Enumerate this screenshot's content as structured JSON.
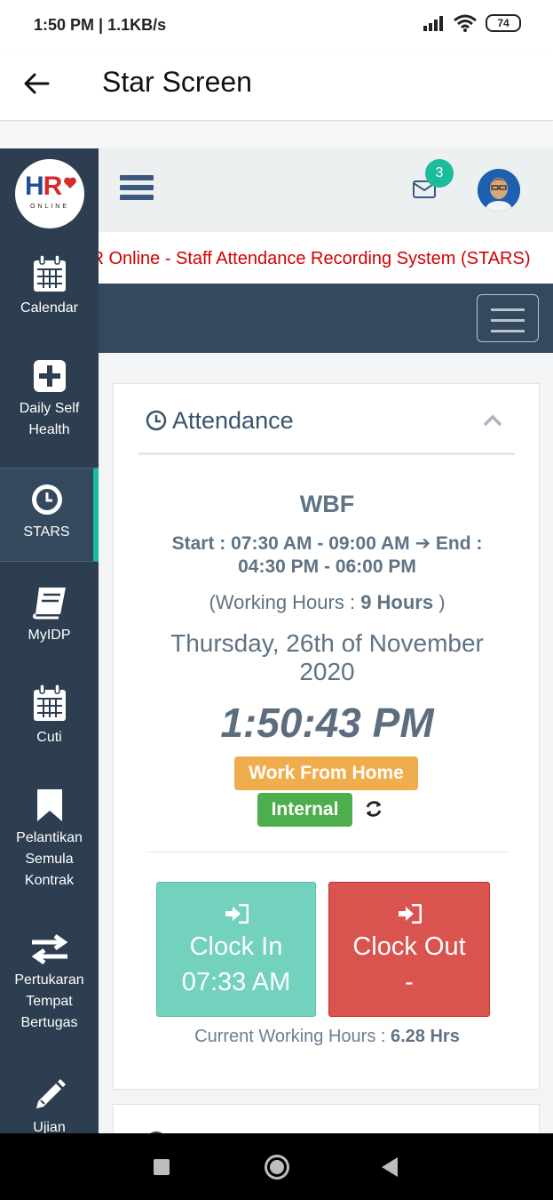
{
  "status_bar": {
    "time": "1:50 PM | 1.1KB/s",
    "battery": "74"
  },
  "app_bar": {
    "title": "Star Screen"
  },
  "sidebar": {
    "logo_text": "HR",
    "logo_sub": "ONLINE",
    "items": [
      {
        "label": "Calendar",
        "icon": "calendar-icon"
      },
      {
        "label": "Daily Self Health",
        "icon": "plus-square-icon"
      },
      {
        "label": "STARS",
        "icon": "clock-icon"
      },
      {
        "label": "MyIDP",
        "icon": "book-icon"
      },
      {
        "label": "Cuti",
        "icon": "calendar-icon"
      },
      {
        "label": "Pelantikan Semula Kontrak",
        "icon": "bookmark-icon"
      },
      {
        "label": "Pertukaran Tempat Bertugas",
        "icon": "exchange-icon"
      },
      {
        "label": "Ujian",
        "icon": "pencil-icon"
      }
    ]
  },
  "topbar": {
    "notification_count": "3"
  },
  "marquee": {
    "text": "HR Online - Staff Attendance Recording System (STARS)"
  },
  "attendance": {
    "title": "Attendance",
    "shift": "WBF",
    "start_end": "Start : 07:30 AM - 09:00 AM ➔ End : 04:30 PM - 06:00 PM",
    "working_hours_prefix": "(Working Hours : ",
    "working_hours_value": "9 Hours",
    "working_hours_suffix": " )",
    "date": "Thursday, 26th of November 2020",
    "clock": "1:50:43 PM",
    "mode_badge": "Work From Home",
    "type_badge": "Internal",
    "clock_in_label": "Clock In",
    "clock_in_time": "07:33 AM",
    "clock_out_label": "Clock Out",
    "clock_out_time": "-",
    "current_hours_label": "Current Working Hours : ",
    "current_hours_value": "6.28 Hrs"
  },
  "colors": {
    "sidebar": "#2c3e50",
    "accent": "#1abc9c",
    "clock_in": "#72d2bd",
    "clock_out": "#d9534f",
    "wfh": "#f0ad4e",
    "internal": "#4cae4c"
  }
}
